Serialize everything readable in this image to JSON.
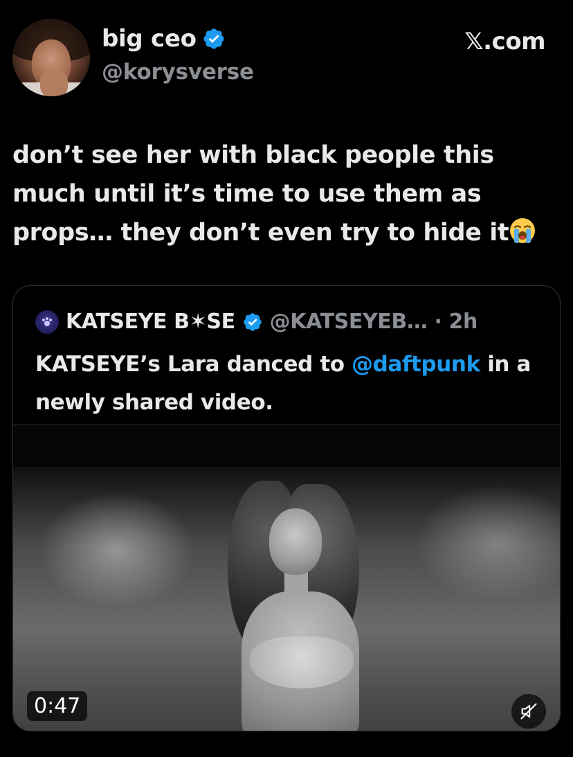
{
  "author": {
    "display_name": "big ceo",
    "handle": "@korysverse",
    "verified": true
  },
  "site_label": "𝕏.com",
  "tweet": {
    "text": "don’t see her with black people this much until it’s time to use them as props… they don’t even try to hide it",
    "emoji": "loudly-crying-face"
  },
  "quote": {
    "display_name": "KATSEYE B✶SE",
    "handle_time": "@KATSEYEB… · 2h",
    "verified": true,
    "text_before": "KATSEYE’s Lara danced to ",
    "mention": "@daftpunk",
    "text_after": " in a newly shared video.",
    "media": {
      "type": "video",
      "duration": "0:47",
      "muted": true
    }
  },
  "colors": {
    "background": "#000000",
    "text": "#e7e9ea",
    "secondary": "#8b8f94",
    "accent": "#1d9bf0",
    "border": "#2f3336"
  }
}
